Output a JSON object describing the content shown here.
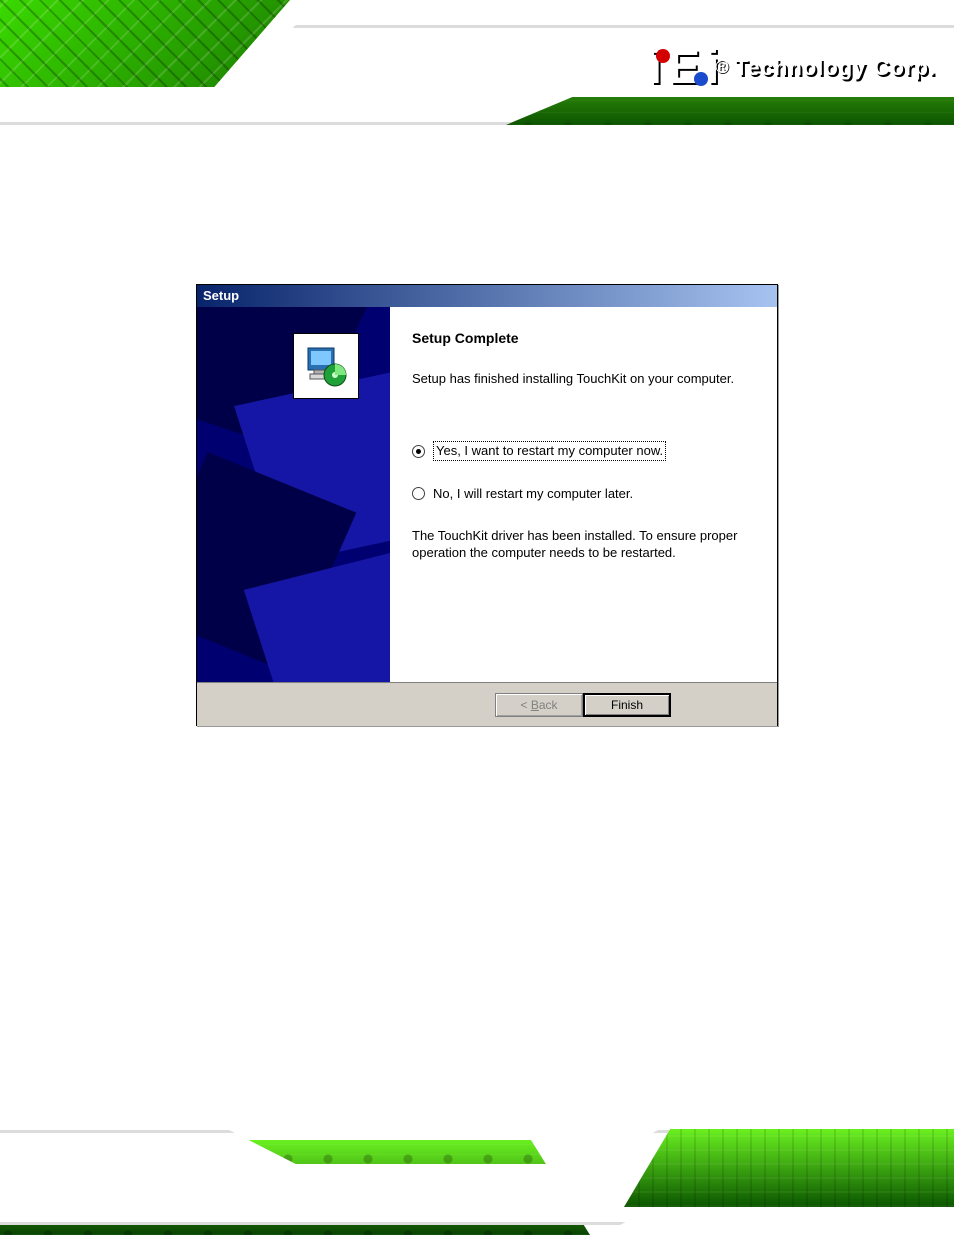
{
  "brand": {
    "logo_letters": "iEi",
    "registered": "®",
    "text": "Technology Corp."
  },
  "dialog": {
    "title": "Setup",
    "heading": "Setup Complete",
    "intro": "Setup has finished installing TouchKit on your computer.",
    "options": {
      "yes": "Yes, I want to restart my computer now.",
      "no": "No, I will restart my computer later."
    },
    "note": "The TouchKit driver has been installed. To ensure proper operation the computer needs to be restarted.",
    "buttons": {
      "back_prefix": "< ",
      "back_letter": "B",
      "back_rest": "ack",
      "finish": "Finish"
    }
  }
}
